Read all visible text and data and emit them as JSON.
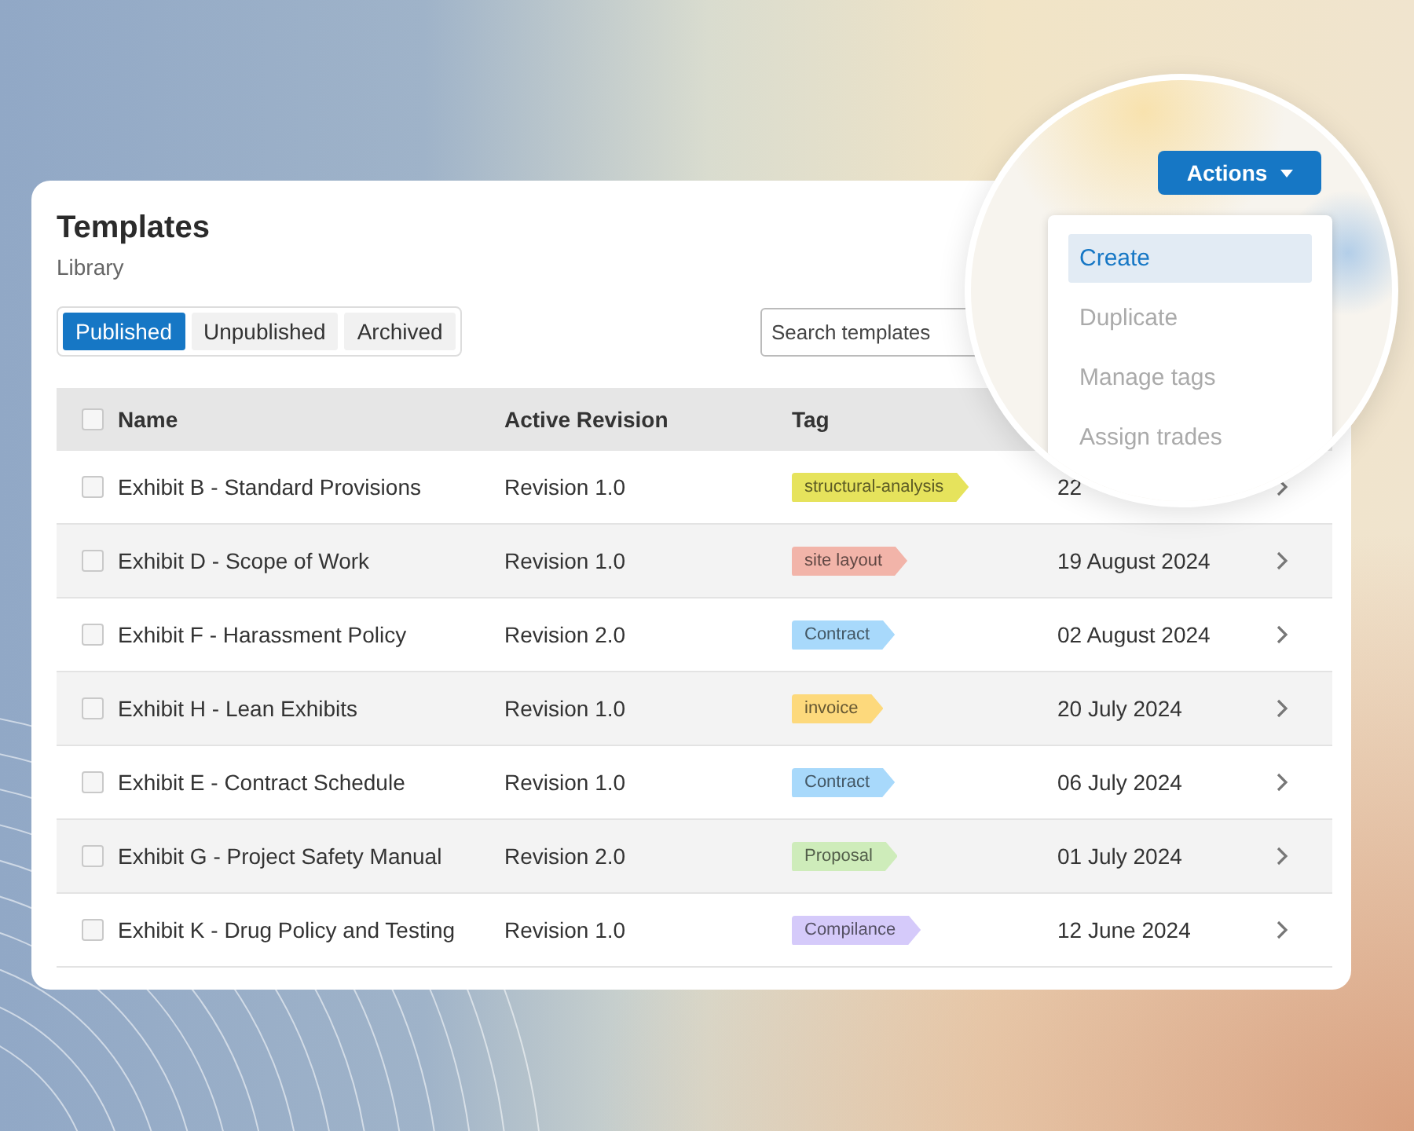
{
  "page": {
    "title": "Templates",
    "subtitle": "Library"
  },
  "tabs": [
    {
      "label": "Published",
      "selected": true
    },
    {
      "label": "Unpublished",
      "selected": false
    },
    {
      "label": "Archived",
      "selected": false
    }
  ],
  "search": {
    "placeholder": "Search templates"
  },
  "table": {
    "select_all_checked": false,
    "columns": [
      "Name",
      "Active Revision",
      "Tag"
    ],
    "rows": [
      {
        "checked": false,
        "name": "Exhibit B - Standard Provisions",
        "revision": "Revision 1.0",
        "tag": {
          "label": "structural-analysis",
          "color": "#e6e35c"
        },
        "date": "22"
      },
      {
        "checked": false,
        "name": "Exhibit D - Scope of Work",
        "revision": "Revision 1.0",
        "tag": {
          "label": "site layout",
          "color": "#f2b4a9"
        },
        "date": "19 August 2024"
      },
      {
        "checked": false,
        "name": "Exhibit F - Harassment Policy",
        "revision": "Revision 2.0",
        "tag": {
          "label": "Contract",
          "color": "#a8d9fb"
        },
        "date": "02 August 2024"
      },
      {
        "checked": false,
        "name": "Exhibit H - Lean Exhibits",
        "revision": "Revision 1.0",
        "tag": {
          "label": "invoice",
          "color": "#fdd97c"
        },
        "date": "20 July 2024"
      },
      {
        "checked": false,
        "name": "Exhibit E - Contract Schedule",
        "revision": "Revision 1.0",
        "tag": {
          "label": "Contract",
          "color": "#a8d9fb"
        },
        "date": "06 July 2024"
      },
      {
        "checked": false,
        "name": "Exhibit G - Project Safety Manual",
        "revision": "Revision 2.0",
        "tag": {
          "label": "Proposal",
          "color": "#ceecba"
        },
        "date": "01 July 2024"
      },
      {
        "checked": false,
        "name": "Exhibit K - Drug Policy and Testing",
        "revision": "Revision 1.0",
        "tag": {
          "label": "Compilance",
          "color": "#d5cafa"
        },
        "date": "12 June 2024"
      }
    ]
  },
  "actions": {
    "label": "Actions",
    "menu": [
      {
        "label": "Create",
        "selected": true,
        "disabled": false
      },
      {
        "label": "Duplicate",
        "selected": false,
        "disabled": true
      },
      {
        "label": "Manage tags",
        "selected": false,
        "disabled": true
      },
      {
        "label": "Assign trades",
        "selected": false,
        "disabled": true
      }
    ]
  }
}
